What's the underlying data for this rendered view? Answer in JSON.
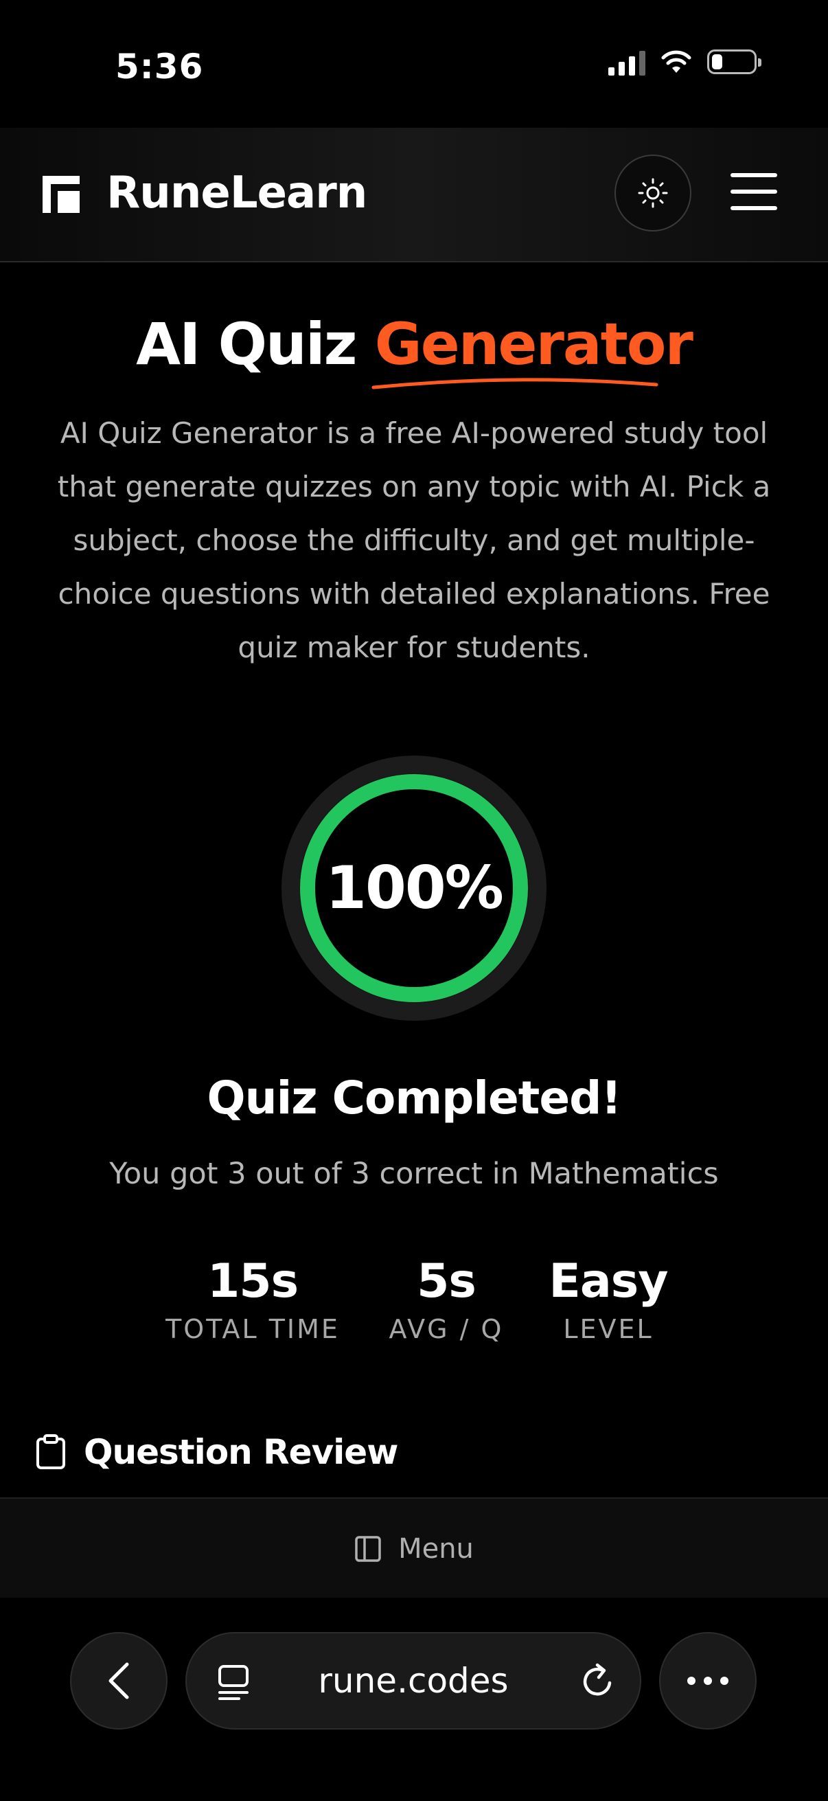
{
  "status": {
    "time": "5:36",
    "battery_level": 0.25
  },
  "header": {
    "brand": "RuneLearn"
  },
  "hero": {
    "title_prefix": "AI Quiz ",
    "title_accent": "Generator",
    "description": "AI Quiz Generator is a free AI-powered study tool that generate quizzes on any topic with AI. Pick a subject, choose the difficulty, and get multiple-choice questions with detailed explanations. Free quiz maker for students."
  },
  "result": {
    "score_percent": 100,
    "score_label": "100%",
    "title": "Quiz Completed!",
    "summary": "You got 3 out of 3 correct in Mathematics",
    "stats": [
      {
        "value": "15s",
        "label": "TOTAL TIME"
      },
      {
        "value": "5s",
        "label": "AVG / Q"
      },
      {
        "value": "Easy",
        "label": "LEVEL"
      }
    ]
  },
  "review": {
    "heading": "Question Review"
  },
  "bottom_menu": {
    "label": "Menu"
  },
  "browser": {
    "url": "rune.codes"
  },
  "colors": {
    "accent": "#ff5a1f",
    "success": "#22c55e",
    "background": "#000000"
  }
}
